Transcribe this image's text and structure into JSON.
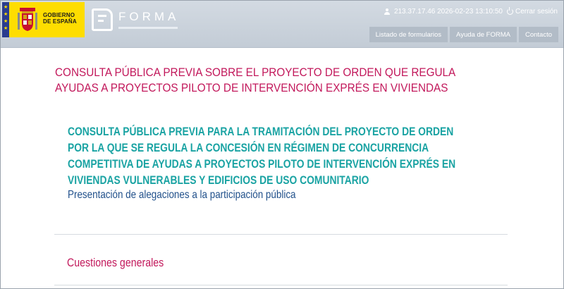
{
  "header": {
    "gobierno_logo_text": "GOBIERNO\nDE ESPAÑA",
    "forma_logo_text": "FORMA",
    "ip_timestamp": "213.37.17.46 2026-02-23 13:10:50",
    "logout_label": "Cerrar sesión",
    "nav": [
      {
        "label": "Listado de formularios"
      },
      {
        "label": "Ayuda de FORMA"
      },
      {
        "label": "Contacto"
      }
    ]
  },
  "main": {
    "title": "CONSULTA PÚBLICA PREVIA SOBRE EL PROYECTO DE ORDEN QUE REGULA AYUDAS A PROYECTOS PILOTO DE INTERVENCIÓN EXPRÉS EN VIVIENDAS",
    "form_title": "CONSULTA PÚBLICA PREVIA PARA LA TRAMITACIÓN DEL PROYECTO DE ORDEN POR LA QUE SE REGULA LA CONCESIÓN EN RÉGIMEN DE CONCURRENCIA COMPETITIVA DE AYUDAS A PROYECTOS PILOTO DE INTERVENCIÓN EXPRÉS EN VIVIENDAS VULNERABLES Y EDIFICIOS DE USO COMUNITARIO",
    "form_subtitle": "Presentación de alegaciones a la participación pública",
    "section_title": "Cuestiones generales"
  },
  "colors": {
    "title": "#c2185b",
    "form_title": "#1aa3a3",
    "subtitle": "#1f4f8a",
    "header_bg": "#c8d0da",
    "logo_yellow": "#fedd00"
  }
}
